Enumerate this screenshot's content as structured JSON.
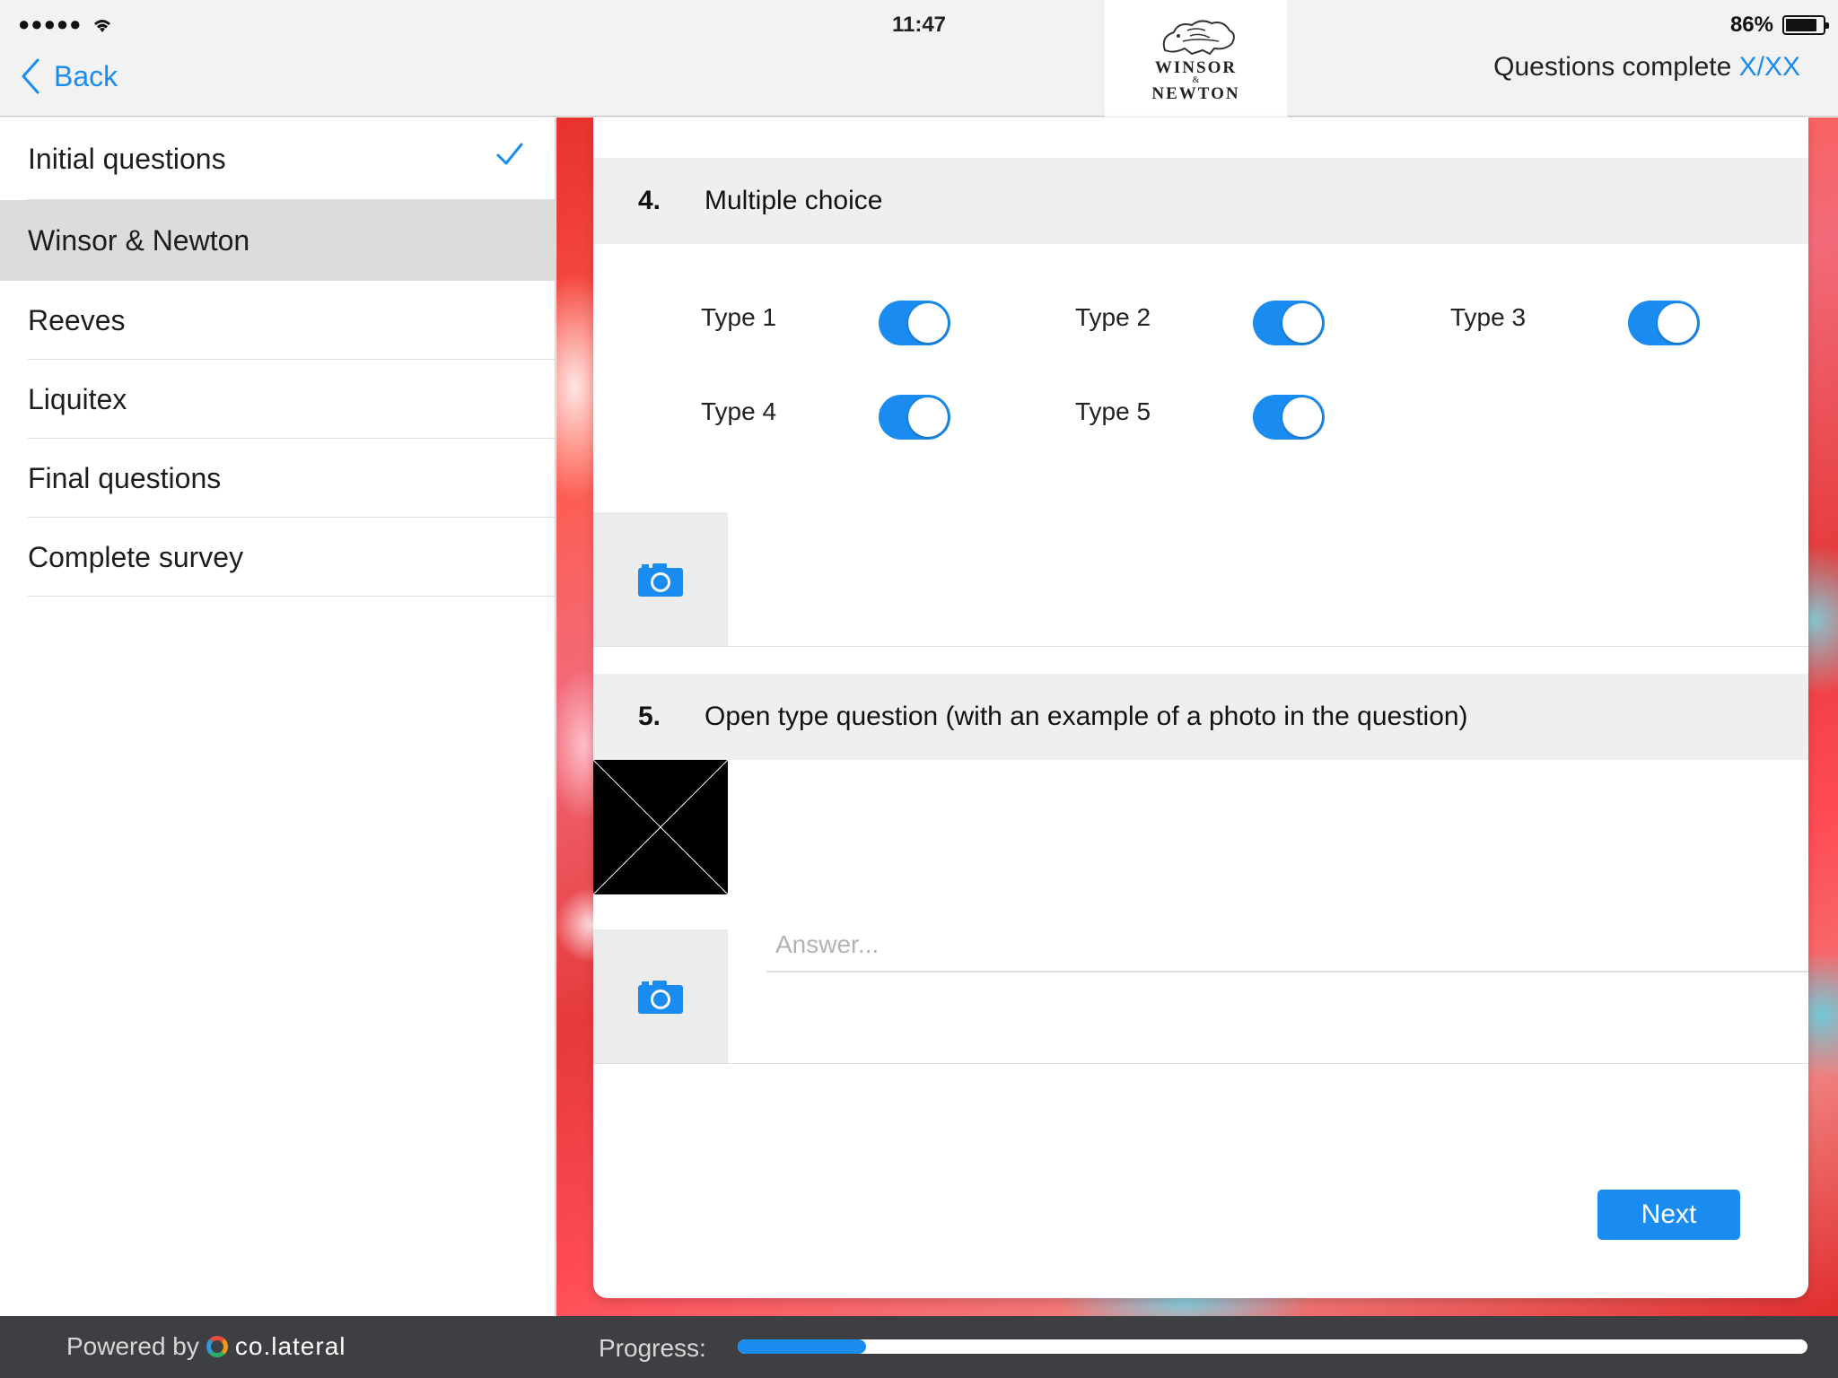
{
  "status_bar": {
    "signal": "●●●●●",
    "time": "11:47",
    "battery_text": "86%",
    "battery_level": 0.86
  },
  "header": {
    "back_label": "Back",
    "brand": {
      "line1": "WINSOR",
      "amp": "&",
      "line2": "NEWTON"
    },
    "questions_complete_label": "Questions complete",
    "questions_complete_count": "X/XX"
  },
  "sidebar": {
    "items": [
      {
        "label": "Initial questions",
        "completed": true
      },
      {
        "label": "Winsor & Newton",
        "active": true
      },
      {
        "label": "Reeves"
      },
      {
        "label": "Liquitex"
      },
      {
        "label": "Final questions"
      },
      {
        "label": "Complete survey"
      }
    ]
  },
  "questions": [
    {
      "number": "4.",
      "title": "Multiple choice",
      "options": [
        {
          "label": "Type 1",
          "on": true
        },
        {
          "label": "Type 2",
          "on": true
        },
        {
          "label": "Type 3",
          "on": true
        },
        {
          "label": "Type 4",
          "on": true
        },
        {
          "label": "Type 5",
          "on": true
        }
      ]
    },
    {
      "number": "5.",
      "title": "Open type question (with an example of a photo in the question)",
      "answer_placeholder": "Answer...",
      "answer_value": ""
    }
  ],
  "footer": {
    "next_label": "Next",
    "powered_by_label": "Powered by",
    "powered_by_brand": "co.lateral",
    "progress_label": "Progress:",
    "progress": 0.12
  },
  "colors": {
    "accent": "#1a8cf0",
    "bottom_bar": "#3e3f42",
    "sidebar_active": "#dcdcdc"
  }
}
